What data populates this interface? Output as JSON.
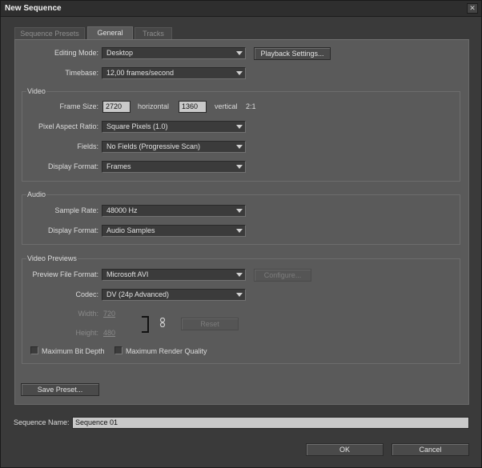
{
  "window": {
    "title": "New Sequence",
    "close_glyph": "✕"
  },
  "tabs": [
    {
      "label": "Sequence Presets",
      "active": false
    },
    {
      "label": "General",
      "active": true
    },
    {
      "label": "Tracks",
      "active": false
    }
  ],
  "general": {
    "editing_mode": {
      "label": "Editing Mode:",
      "value": "Desktop"
    },
    "playback_settings": "Playback Settings...",
    "timebase": {
      "label": "Timebase:",
      "value": "12,00 frames/second"
    }
  },
  "video": {
    "group_title": "Video",
    "frame_size": {
      "label": "Frame Size:",
      "horizontal": "2720",
      "horizontal_label": "horizontal",
      "vertical": "1360",
      "vertical_label": "vertical",
      "ratio": "2:1"
    },
    "pixel_aspect": {
      "label": "Pixel Aspect Ratio:",
      "value": "Square Pixels (1.0)"
    },
    "fields": {
      "label": "Fields:",
      "value": "No Fields (Progressive Scan)"
    },
    "display_format": {
      "label": "Display Format:",
      "value": "Frames"
    }
  },
  "audio": {
    "group_title": "Audio",
    "sample_rate": {
      "label": "Sample Rate:",
      "value": "48000 Hz"
    },
    "display_format": {
      "label": "Display Format:",
      "value": "Audio Samples"
    }
  },
  "video_previews": {
    "group_title": "Video Previews",
    "file_format": {
      "label": "Preview File Format:",
      "value": "Microsoft AVI"
    },
    "configure": "Configure...",
    "codec": {
      "label": "Codec:",
      "value": "DV (24p Advanced)"
    },
    "width": {
      "label": "Width:",
      "value": "720"
    },
    "height": {
      "label": "Height:",
      "value": "480"
    },
    "reset": "Reset",
    "max_bit_depth": {
      "label": "Maximum Bit Depth",
      "checked": false
    },
    "max_render_quality": {
      "label": "Maximum Render Quality",
      "checked": false
    }
  },
  "save_preset": "Save Preset...",
  "sequence_name": {
    "label": "Sequence Name:",
    "value": "Sequence 01"
  },
  "footer": {
    "ok": "OK",
    "cancel": "Cancel"
  }
}
